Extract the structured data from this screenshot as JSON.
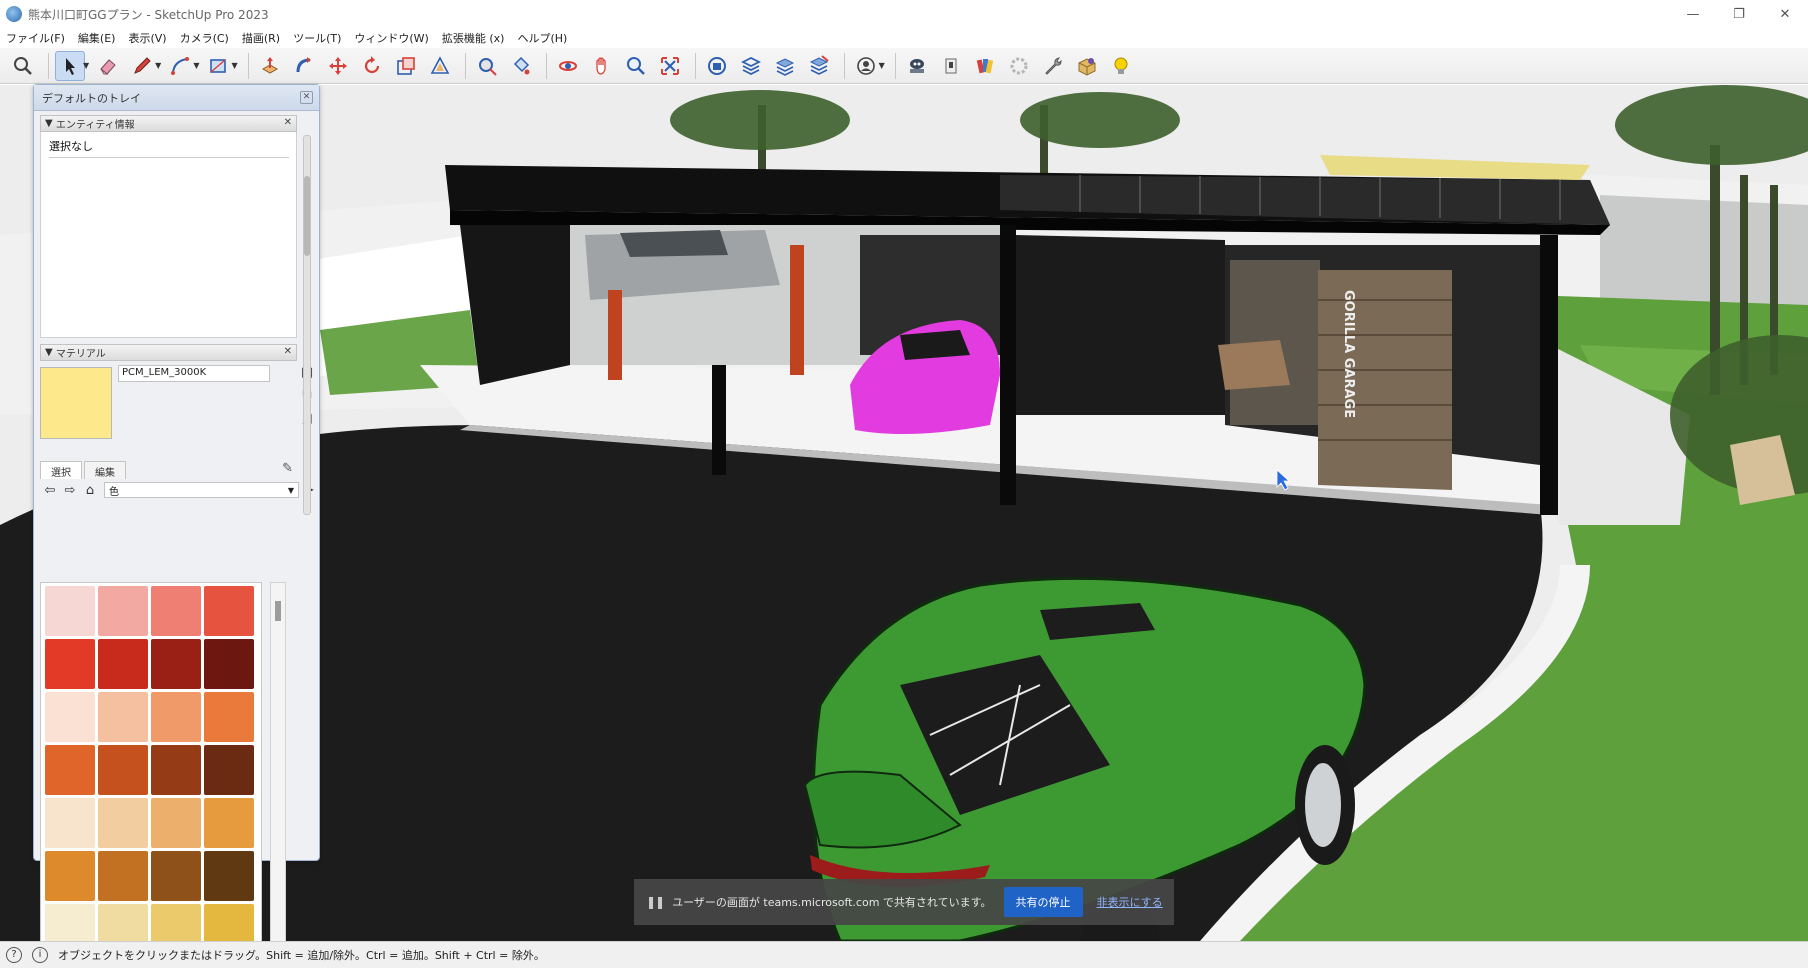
{
  "window": {
    "title": "熊本川口町GGプラン - SketchUp Pro 2023"
  },
  "menu": [
    "ファイル(F)",
    "編集(E)",
    "表示(V)",
    "カメラ(C)",
    "描画(R)",
    "ツール(T)",
    "ウィンドウ(W)",
    "拡張機能 (x)",
    "ヘルプ(H)"
  ],
  "tray": {
    "title": "デフォルトのトレイ",
    "entity_section": "エンティティ情報",
    "entity_value": "選択なし",
    "material_section": "マテリアル",
    "material_name": "PCM_LEM_3000K",
    "tab_select": "選択",
    "tab_edit": "編集",
    "library_select": "色"
  },
  "palette": {
    "colors": [
      "#f7d7d3",
      "#f2a9a2",
      "#ee7f72",
      "#e6533f",
      "#e23a26",
      "#c82a1b",
      "#9a2015",
      "#6c1710",
      "#fbe1d3",
      "#f5c0a0",
      "#f09a69",
      "#ea7a3c",
      "#e0652a",
      "#c5521e",
      "#953c17",
      "#6a2b12",
      "#f8e3cc",
      "#f2cd9f",
      "#ecb06c",
      "#e79b3f",
      "#dd8a2c",
      "#c27021",
      "#8e5119",
      "#603913",
      "#f6ecd0",
      "#f0dca0",
      "#ebca6c",
      "#e4b83e"
    ]
  },
  "share_banner": {
    "text": "ユーザーの画面が teams.microsoft.com で共有されています。",
    "stop_label": "共有の停止",
    "hide_label": "非表示にする"
  },
  "status": {
    "text": "オブジェクトをクリックまたはドラッグ。Shift = 追加/除外。Ctrl = 追加。Shift + Ctrl = 除外。"
  },
  "scene": {
    "sign_text": "GORILLA GARAGE"
  },
  "colors": {
    "accent": "#1f63c6",
    "tray_border": "#9eb3cf",
    "swatch": "#fde98b"
  }
}
